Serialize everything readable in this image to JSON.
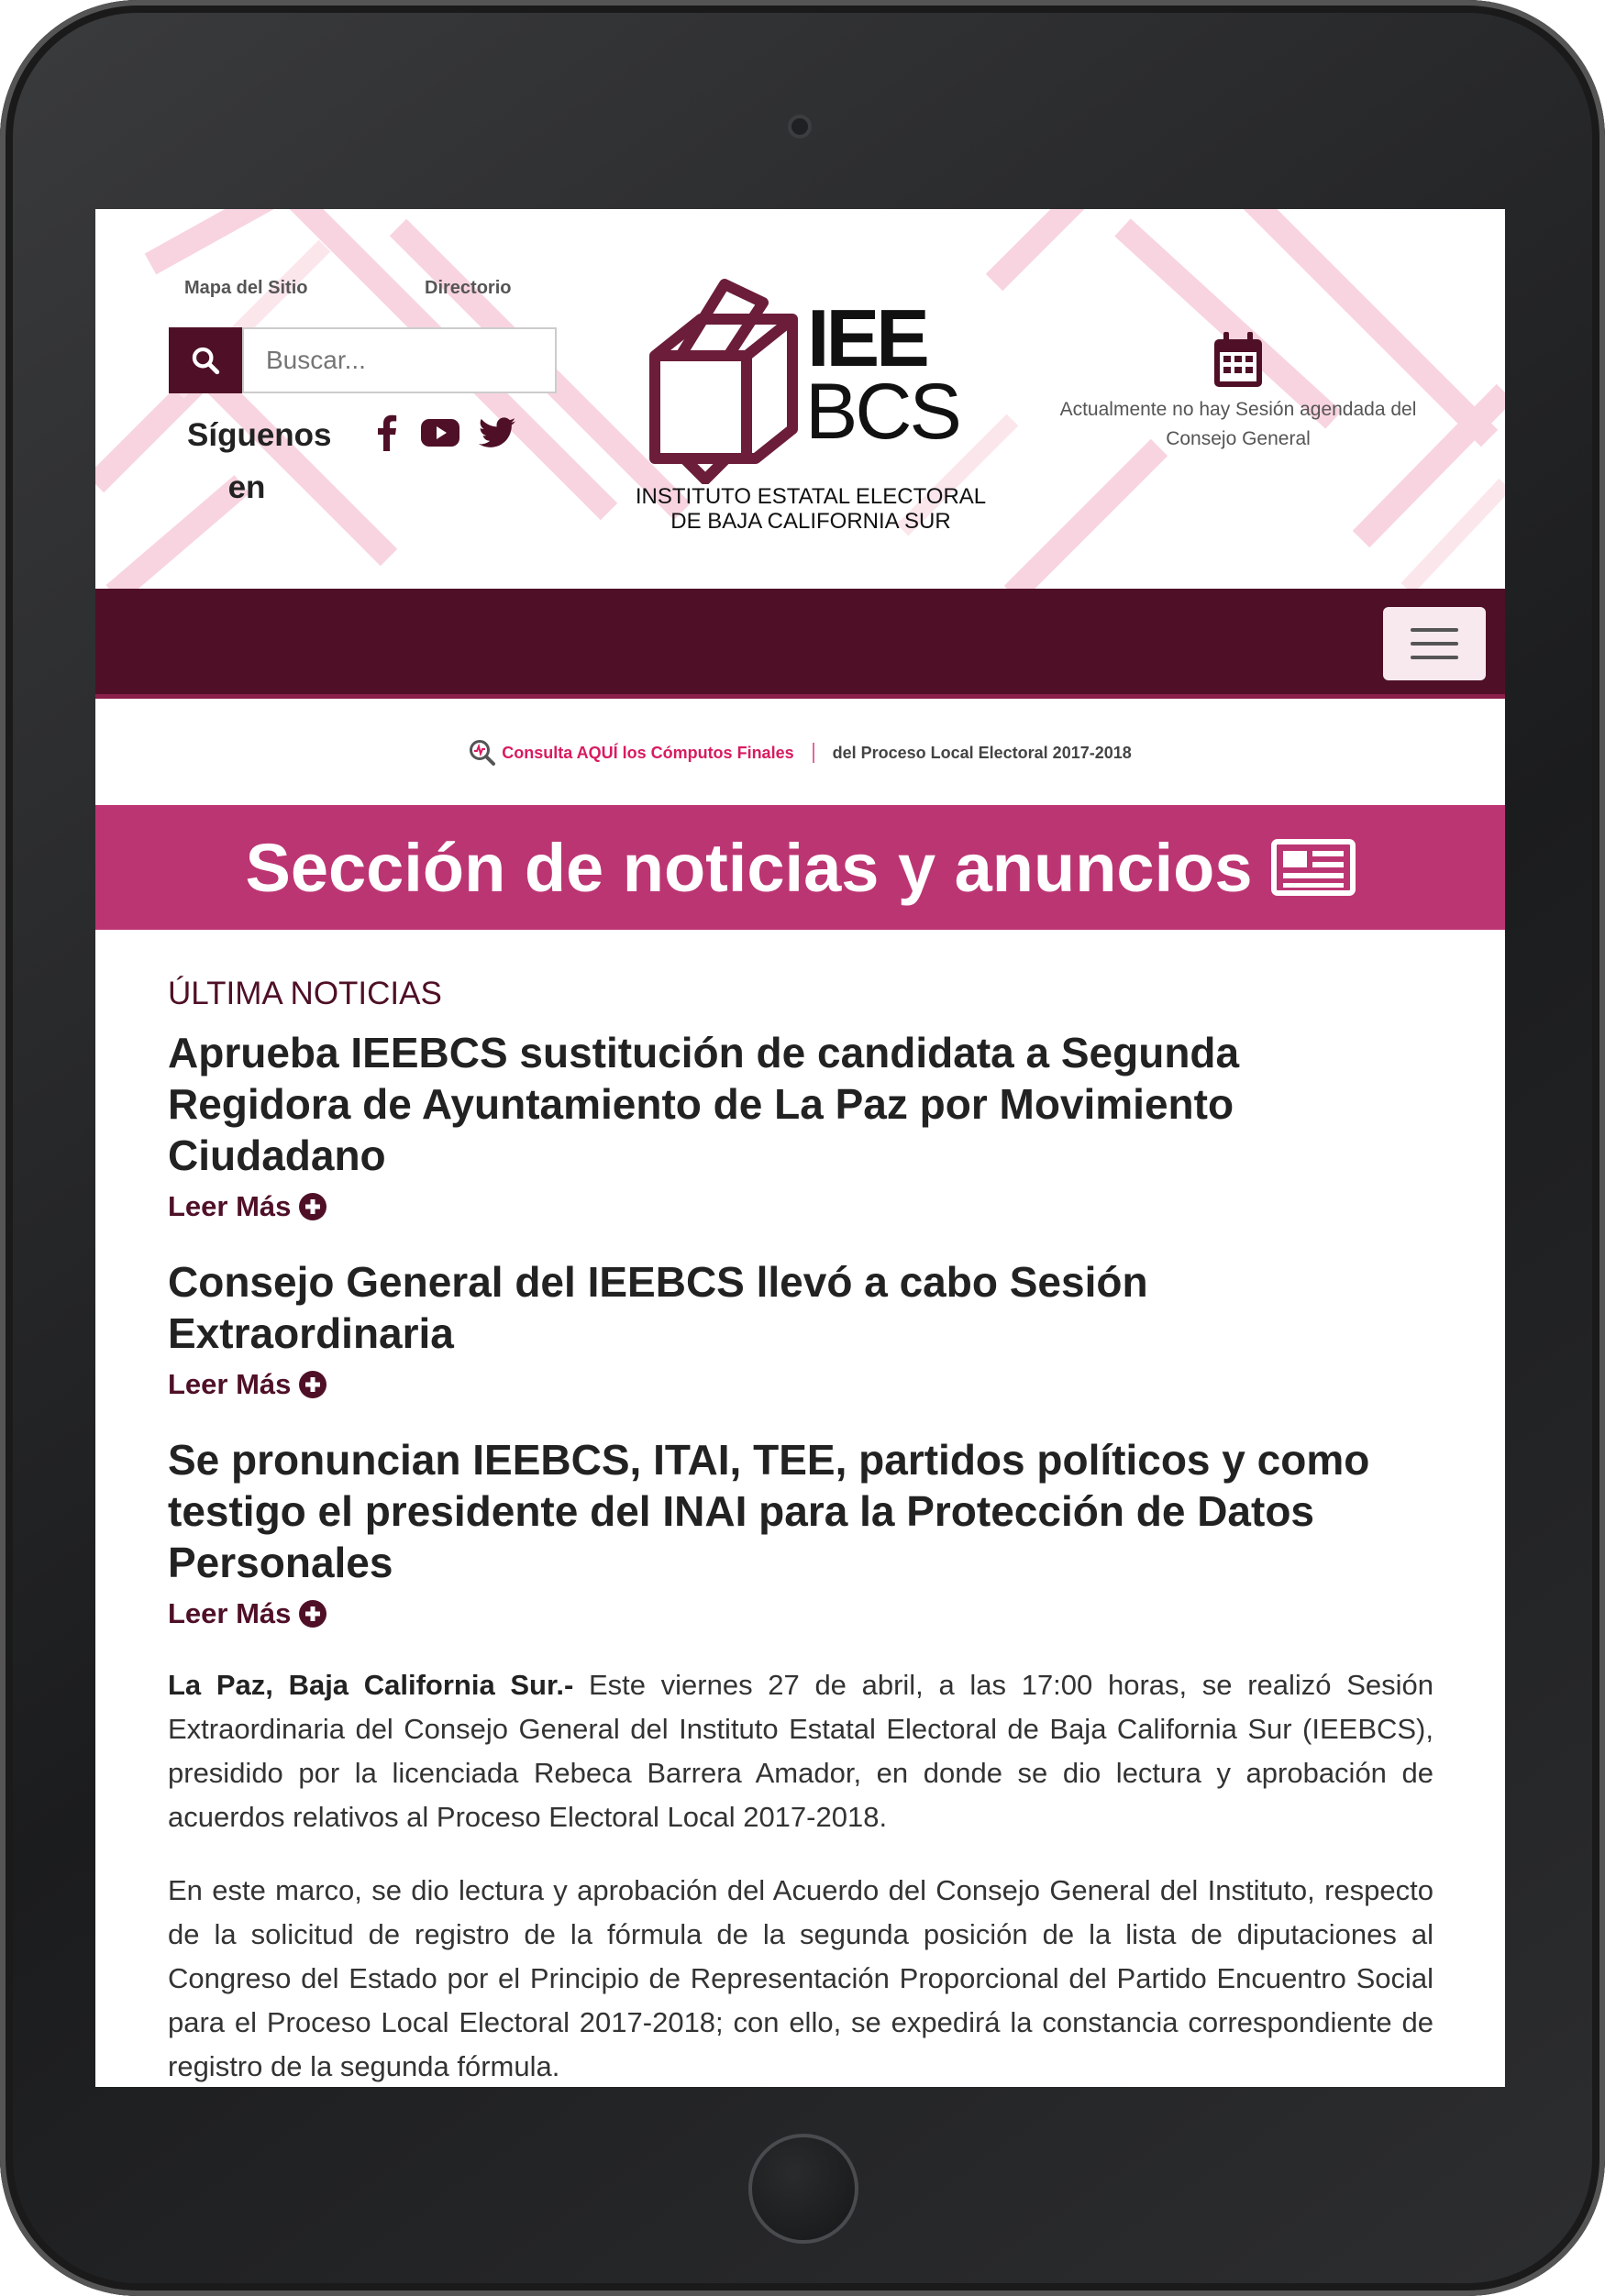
{
  "header": {
    "top_links": [
      "Mapa del Sitio",
      "Directorio"
    ],
    "search": {
      "placeholder": "Buscar..."
    },
    "follow_label": "Síguenos en",
    "social_icons": [
      "facebook-icon",
      "youtube-icon",
      "twitter-icon"
    ],
    "logo": {
      "line1": "IEE",
      "line2": "BCS",
      "caption_line1": "INSTITUTO ESTATAL ELECTORAL",
      "caption_line2": "DE BAJA CALIFORNIA SUR"
    },
    "session_notice": "Actualmente no hay Sesión agendada del Consejo General"
  },
  "nav": {
    "menu_icon": "hamburger-icon"
  },
  "consulta": {
    "link_text": "Consulta AQUÍ los Cómputos Finales",
    "rest_text": "del Proceso Local Electoral 2017-2018"
  },
  "banner": {
    "title": "Sección de noticias y anuncios"
  },
  "news": {
    "section_label": "ÚLTIMA NOTICIAS",
    "read_more_label": "Leer Más",
    "items": [
      {
        "title": "Aprueba IEEBCS sustitución de candidata a Segunda Regidora de Ayuntamiento de La Paz por Movimiento Ciudadano"
      },
      {
        "title": "Consejo General del IEEBCS llevó a cabo Sesión Extraordinaria"
      },
      {
        "title": "Se pronuncian IEEBCS, ITAI, TEE, partidos políticos y como testigo el presidente del INAI para la Protección de Datos Personales"
      }
    ],
    "article": {
      "lead_bold": "La Paz, Baja California Sur.-",
      "lead_text": " Este viernes 27 de abril, a las 17:00 horas, se realizó Sesión Extraordinaria del Consejo General del Instituto Estatal Electoral de Baja California Sur (IEEBCS), presidido por la licenciada Rebeca Barrera Amador, en donde se dio lectura y aprobación de acuerdos relativos al Proceso Electoral Local 2017-2018.",
      "paragraph2": "En este marco, se dio lectura y aprobación del Acuerdo del Consejo General del Instituto, respecto de la solicitud de registro de la fórmula de la segunda posición de la lista de diputaciones al Congreso del Estado por el Principio de Representación Proporcional del Partido Encuentro Social para el Proceso Local Electoral 2017-2018; con ello, se expedirá la constancia correspondiente de registro de la segunda fórmula."
    }
  },
  "colors": {
    "primary": "#4f1027",
    "banner": "#bc3573",
    "accent_link": "#d81b60"
  }
}
